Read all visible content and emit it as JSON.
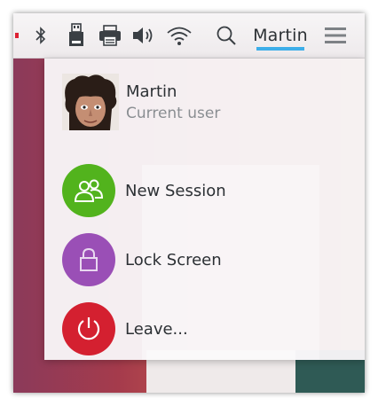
{
  "panel": {
    "icons": [
      "bluetooth-icon",
      "usb-drive-icon",
      "printer-icon",
      "volume-icon",
      "wifi-icon",
      "search-icon",
      "hamburger-menu-icon"
    ],
    "user_label": "Martin",
    "accent_color": "#3daee9"
  },
  "popup": {
    "user": {
      "name": "Martin",
      "subtitle": "Current user",
      "avatar_icon": "user-avatar"
    },
    "actions": [
      {
        "label": "New Session",
        "icon": "users-icon",
        "color": "#52b31d"
      },
      {
        "label": "Lock Screen",
        "icon": "lock-icon",
        "color": "#9a4fb6"
      },
      {
        "label": "Leave...",
        "icon": "power-icon",
        "color": "#d42030"
      }
    ]
  }
}
